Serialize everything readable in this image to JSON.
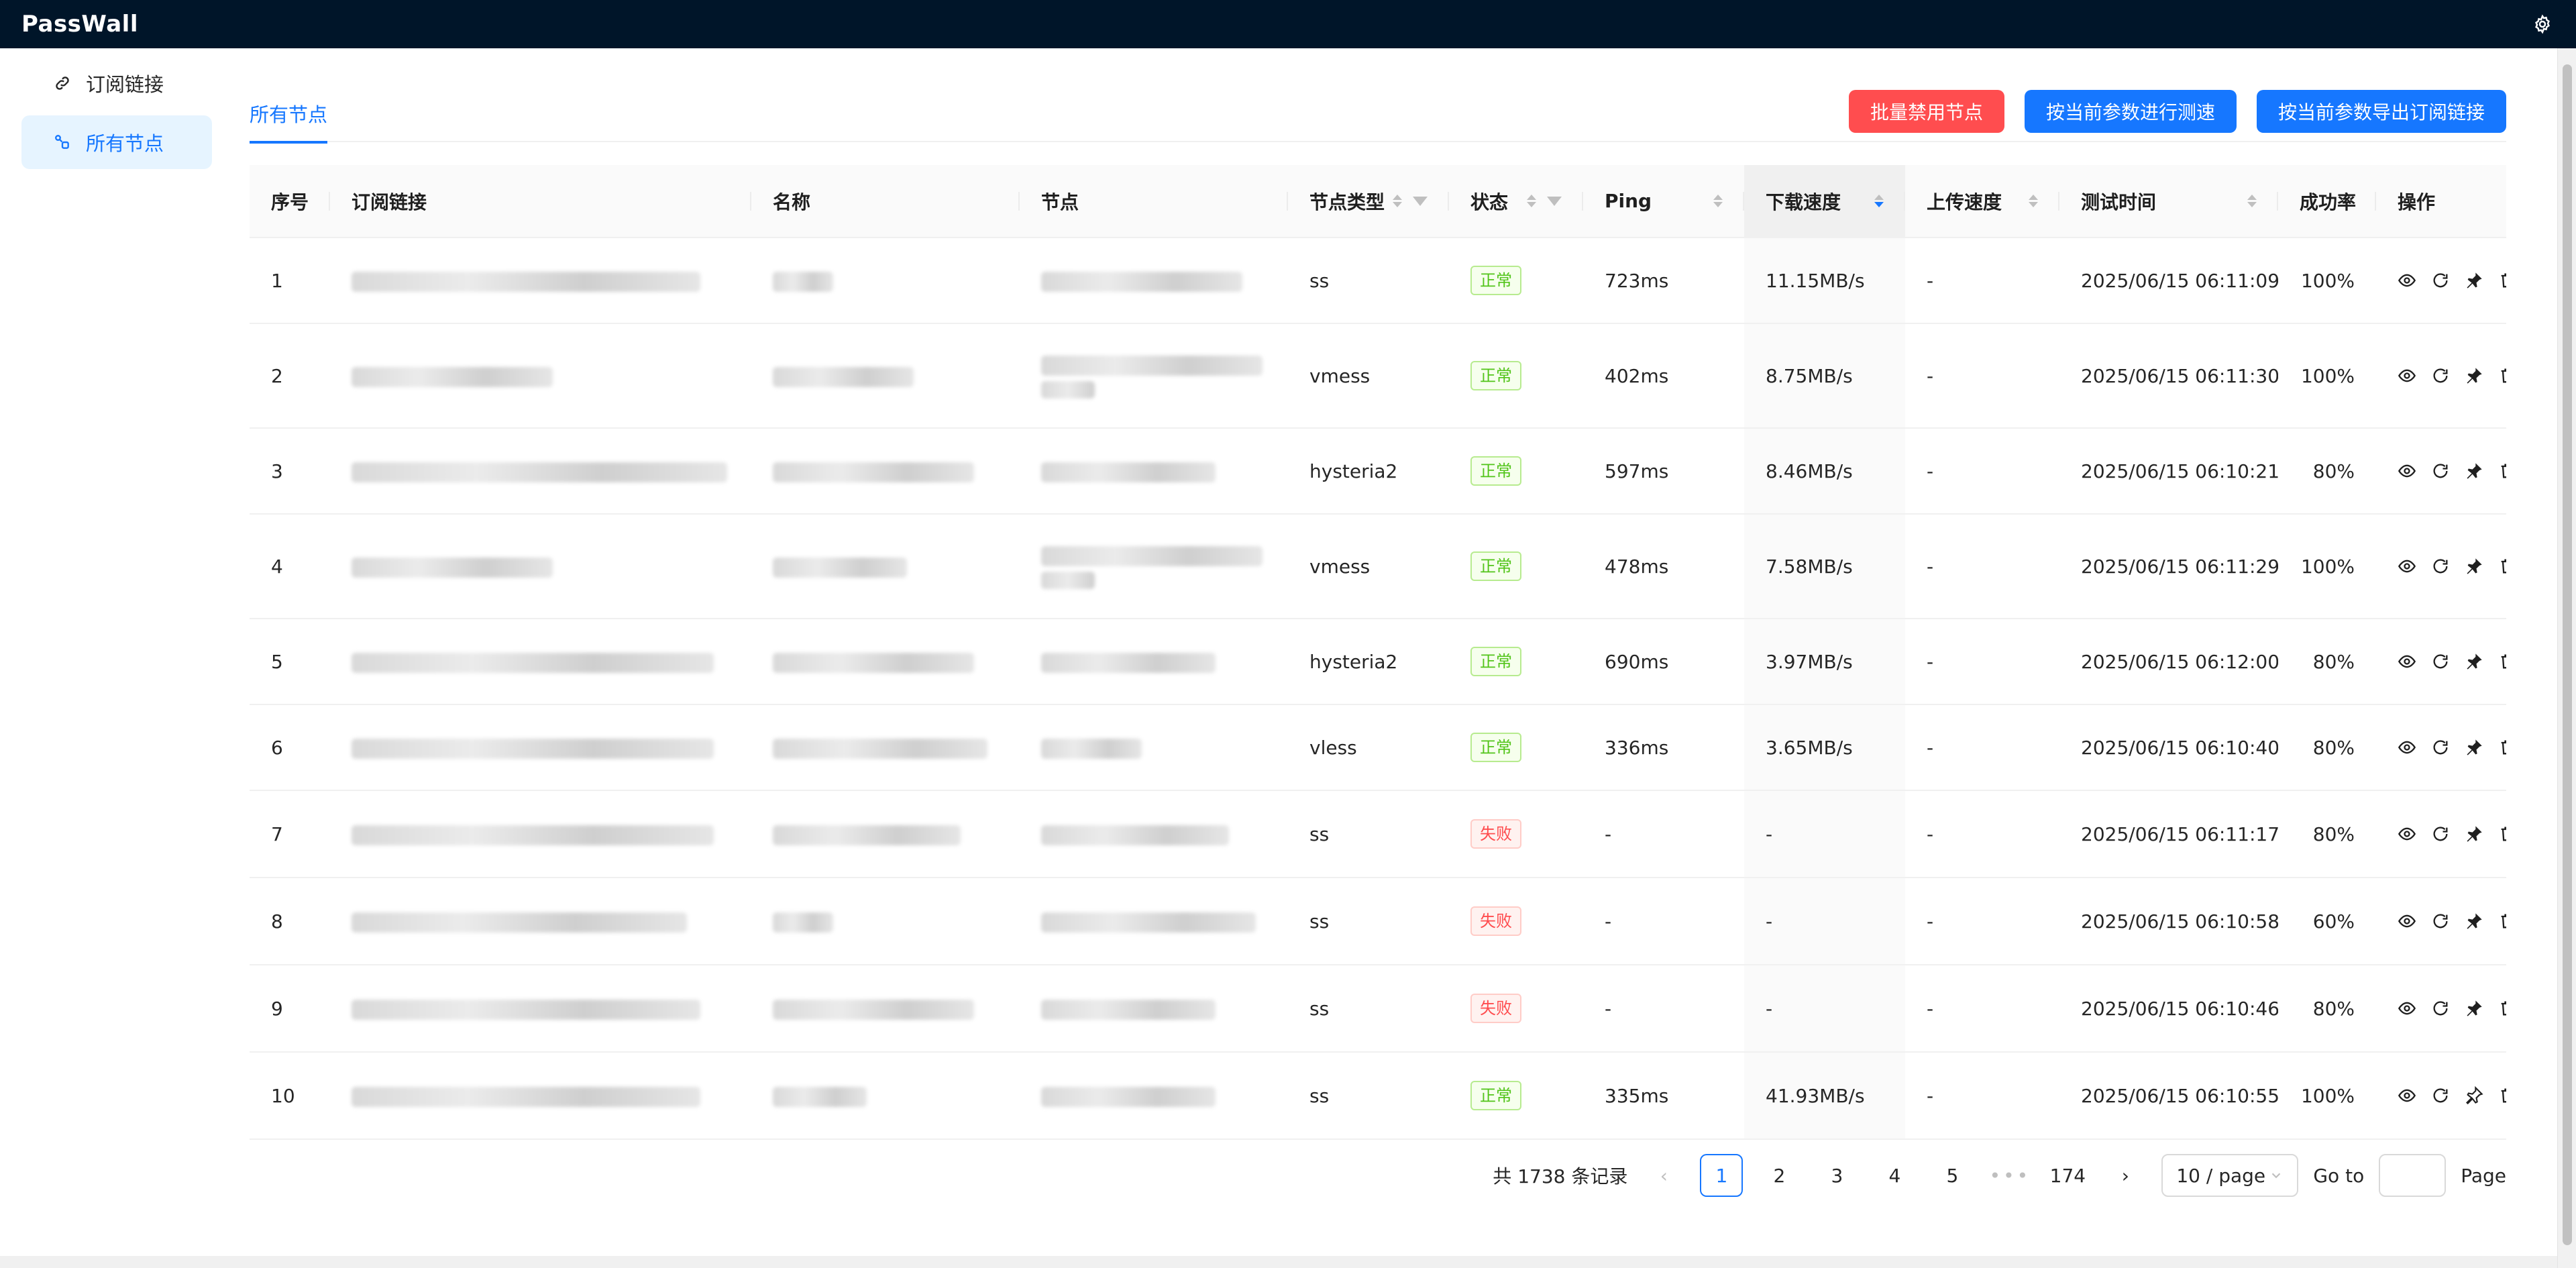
{
  "app": {
    "title": "PassWall",
    "settings_icon": "gear-icon"
  },
  "sidebar": {
    "items": [
      {
        "label": "订阅链接",
        "icon": "link-icon",
        "active": false
      },
      {
        "label": "所有节点",
        "icon": "node-link-icon",
        "active": true
      }
    ]
  },
  "tabs": [
    {
      "label": "所有节点"
    }
  ],
  "actions": {
    "batch_disable": "批量禁用节点",
    "speed_test": "按当前参数进行测速",
    "export_sub": "按当前参数导出订阅链接"
  },
  "table": {
    "columns": {
      "index": "序号",
      "subscription": "订阅链接",
      "name": "名称",
      "node": "节点",
      "type": "节点类型",
      "status": "状态",
      "ping": "Ping",
      "download": "下载速度",
      "upload": "上传速度",
      "test_time": "测试时间",
      "success": "成功率",
      "ops": "操作"
    },
    "rows": [
      {
        "index": "1",
        "type": "ss",
        "status": "正常",
        "ok": true,
        "ping": "723ms",
        "download": "11.15MB/s",
        "upload": "-",
        "test_time": "2025/06/15 06:11:09",
        "success": "100%"
      },
      {
        "index": "2",
        "type": "vmess",
        "status": "正常",
        "ok": true,
        "ping": "402ms",
        "download": "8.75MB/s",
        "upload": "-",
        "test_time": "2025/06/15 06:11:30",
        "success": "100%"
      },
      {
        "index": "3",
        "type": "hysteria2",
        "status": "正常",
        "ok": true,
        "ping": "597ms",
        "download": "8.46MB/s",
        "upload": "-",
        "test_time": "2025/06/15 06:10:21",
        "success": "80%"
      },
      {
        "index": "4",
        "type": "vmess",
        "status": "正常",
        "ok": true,
        "ping": "478ms",
        "download": "7.58MB/s",
        "upload": "-",
        "test_time": "2025/06/15 06:11:29",
        "success": "100%"
      },
      {
        "index": "5",
        "type": "hysteria2",
        "status": "正常",
        "ok": true,
        "ping": "690ms",
        "download": "3.97MB/s",
        "upload": "-",
        "test_time": "2025/06/15 06:12:00",
        "success": "80%"
      },
      {
        "index": "6",
        "type": "vless",
        "status": "正常",
        "ok": true,
        "ping": "336ms",
        "download": "3.65MB/s",
        "upload": "-",
        "test_time": "2025/06/15 06:10:40",
        "success": "80%"
      },
      {
        "index": "7",
        "type": "ss",
        "status": "失败",
        "ok": false,
        "ping": "-",
        "download": "-",
        "upload": "-",
        "test_time": "2025/06/15 06:11:17",
        "success": "80%"
      },
      {
        "index": "8",
        "type": "ss",
        "status": "失败",
        "ok": false,
        "ping": "-",
        "download": "-",
        "upload": "-",
        "test_time": "2025/06/15 06:10:58",
        "success": "60%"
      },
      {
        "index": "9",
        "type": "ss",
        "status": "失败",
        "ok": false,
        "ping": "-",
        "download": "-",
        "upload": "-",
        "test_time": "2025/06/15 06:10:46",
        "success": "80%"
      },
      {
        "index": "10",
        "type": "ss",
        "status": "正常",
        "ok": true,
        "ping": "335ms",
        "download": "41.93MB/s",
        "upload": "-",
        "test_time": "2025/06/15 06:10:55",
        "success": "100%"
      }
    ],
    "row_icons": [
      "eye-icon",
      "refresh-icon",
      "pin-icon",
      "trash-icon"
    ]
  },
  "pagination": {
    "total_text": "共 1738 条记录",
    "pages": [
      "1",
      "2",
      "3",
      "4",
      "5"
    ],
    "current": "1",
    "ellipsis": "•••",
    "last_page": "174",
    "page_size": "10 / page",
    "goto_label": "Go to",
    "page_label": "Page"
  },
  "colors": {
    "header_bg": "#001529",
    "primary": "#1677ff",
    "danger": "#ff4d4f",
    "success": "#52c41a"
  }
}
